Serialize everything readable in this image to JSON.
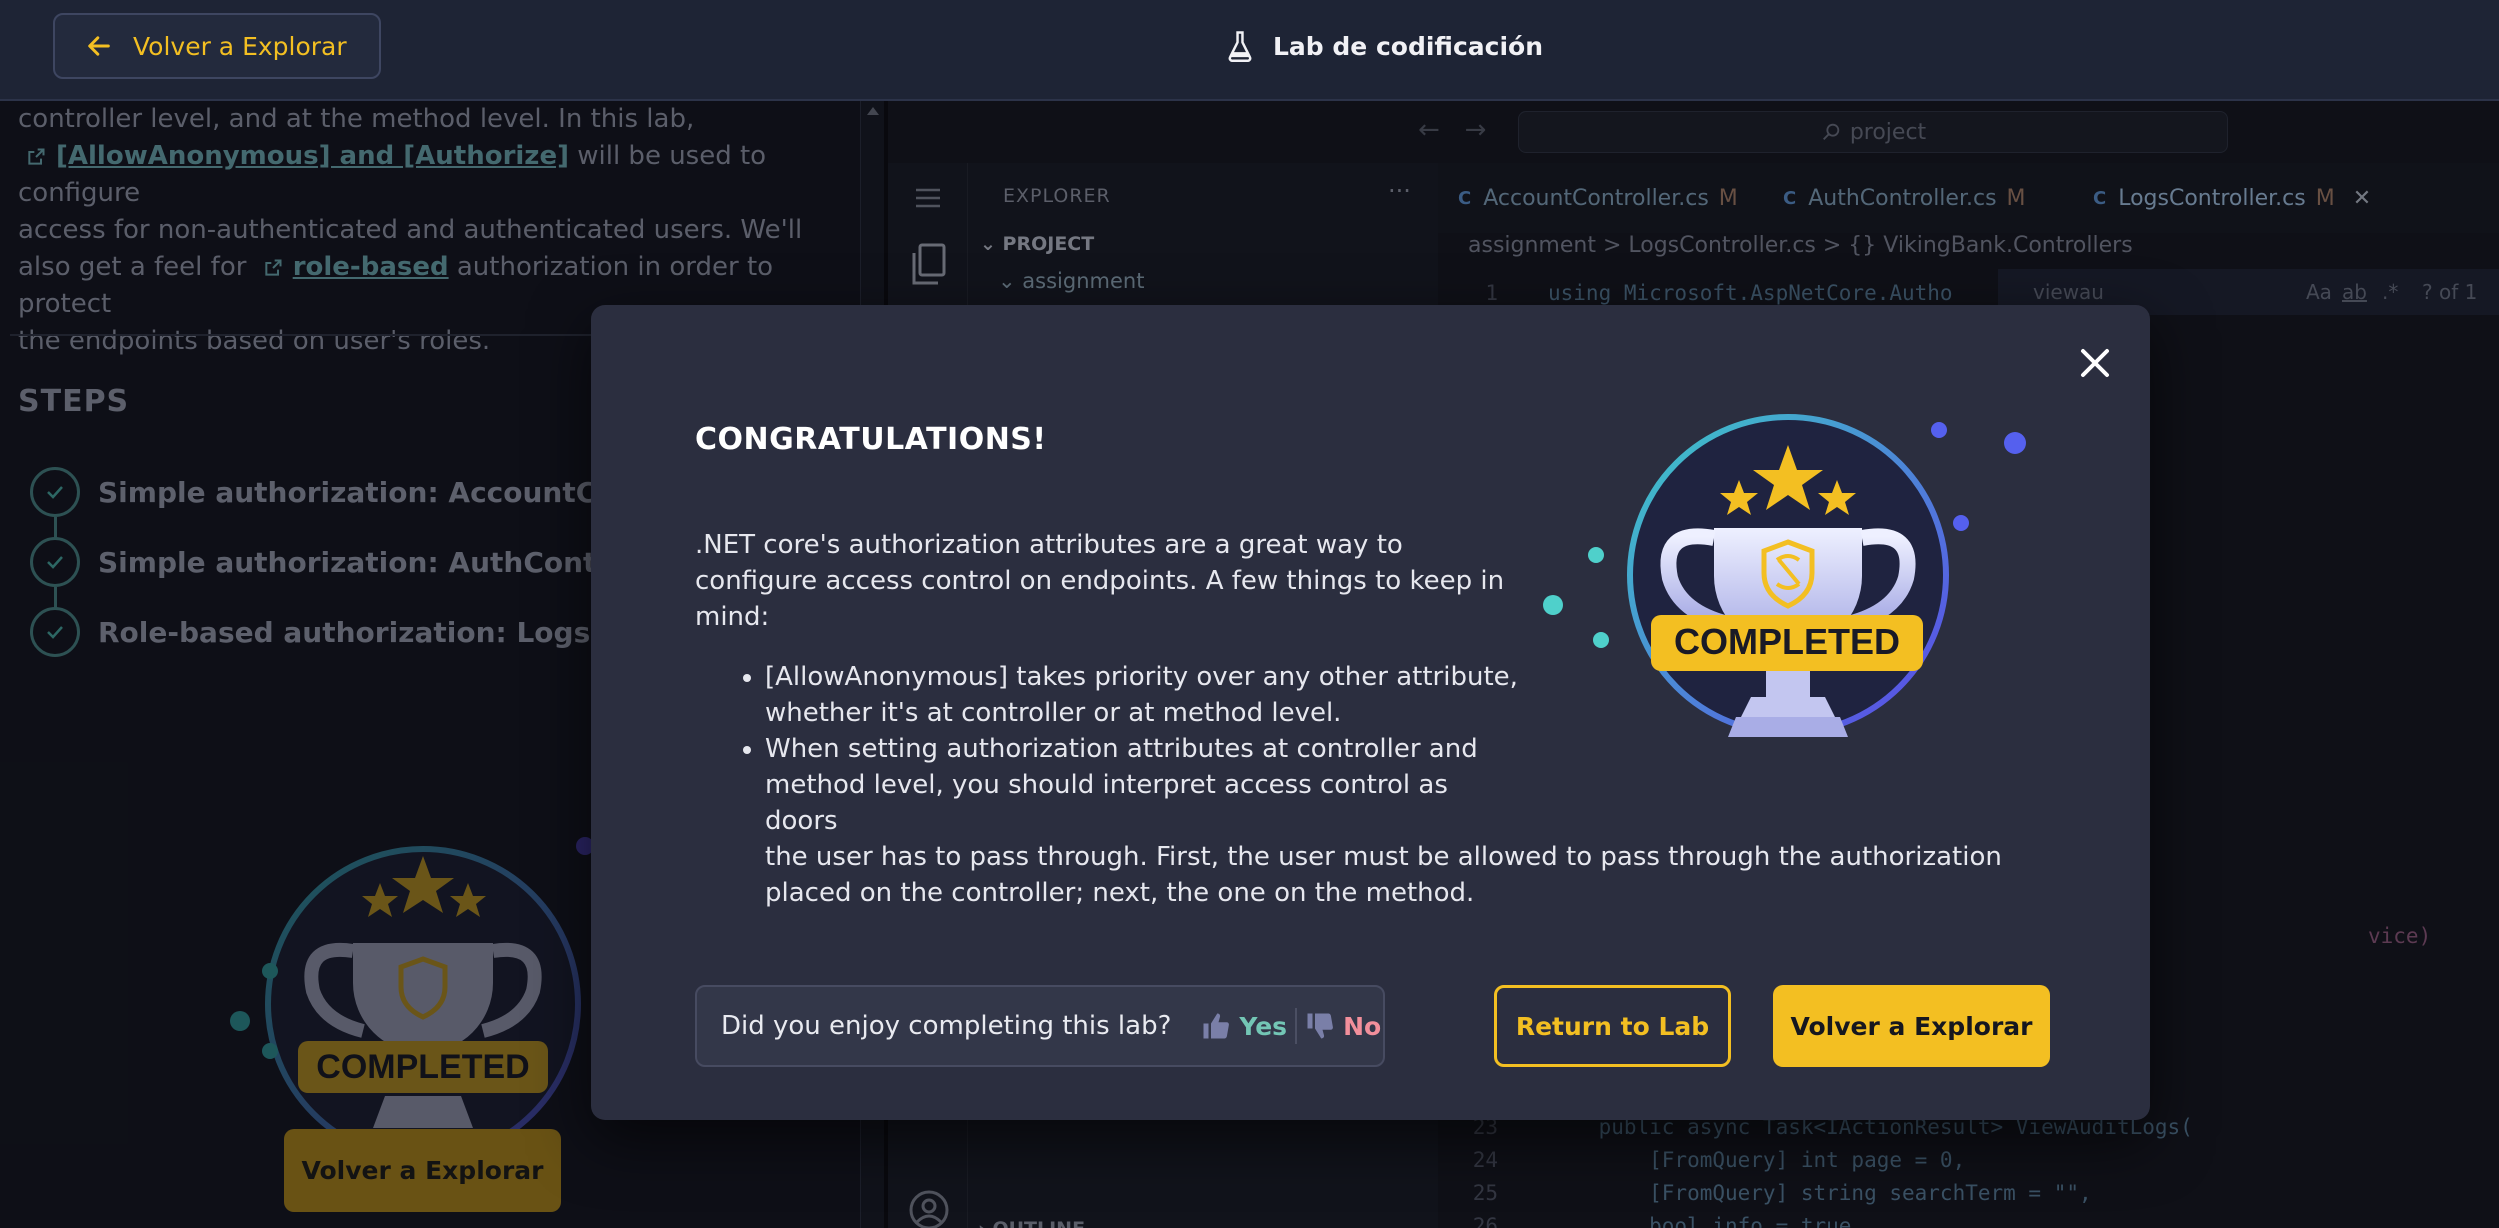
{
  "header": {
    "back_label": "Volver a Explorar",
    "title": "Lab de codificación"
  },
  "left": {
    "intro_line1": "controller level, and at the method level. In this lab,",
    "link1": "[AllowAnonymous] and [Authorize]",
    "intro_line2": " will be used to configure",
    "intro_line3": "access for non-authenticated and authenticated users. We'll",
    "intro_line4a": "also get a feel for ",
    "link2": "role-based",
    "intro_line4b": " authorization in order to protect",
    "intro_line5": "the endpoints based on user's roles.",
    "steps_title": "STEPS",
    "steps": [
      {
        "label": "Simple authorization: AccountContr"
      },
      {
        "label": "Simple authorization: AuthControlle"
      },
      {
        "label": "Role-based authorization: LogsCon"
      }
    ],
    "badge_text": "COMPLETED",
    "explore_label": "Volver a Explorar"
  },
  "ide": {
    "search": "project",
    "explorer_title": "EXPLORER",
    "project": "PROJECT",
    "folder": "assignment",
    "outline": "OUTLINE",
    "tabs": [
      {
        "name": "AccountController.cs",
        "status": "M"
      },
      {
        "name": "AuthController.cs",
        "status": "M"
      },
      {
        "name": "LogsController.cs",
        "status": "M"
      }
    ],
    "breadcrumb": "assignment  >  LogsController.cs  >  {} VikingBank.Controllers",
    "find_value": "viewau",
    "find_count": "? of 1",
    "code": [
      {
        "ln": "1",
        "text": "using Microsoft.AspNetCore.Autho"
      },
      {
        "ln": "23",
        "text": "    public async Task<IActionResult> ViewAuditLogs("
      },
      {
        "ln": "24",
        "text": "        [FromQuery] int page = 0,"
      },
      {
        "ln": "25",
        "text": "        [FromQuery] string searchTerm = \"\","
      },
      {
        "ln": "26",
        "text": "        bool info = true,"
      }
    ],
    "partial": "vice)"
  },
  "modal": {
    "title": "CONGRATULATIONS!",
    "intro": ".NET core's authorization attributes are a great way to configure access control on endpoints. A few things to keep in mind:",
    "bullet1": "[AllowAnonymous] takes priority over any other attribute, whether it's at controller or at method level.",
    "bullet2a": "When setting authorization attributes at controller and method level, you should interpret access control as doors",
    "bullet2b": "the user has to pass through. First, the user must be allowed to pass through the authorization placed on the controller; next, the one on the method.",
    "badge_text": "COMPLETED",
    "feedback_question": "Did you enjoy completing this lab?",
    "yes": "Yes",
    "no": "No",
    "return_label": "Return to Lab",
    "explore_label": "Volver a Explorar"
  },
  "colors": {
    "accent": "#f3bf22",
    "modal_bg": "#2b2e3f",
    "yes": "#73c6b5",
    "no": "#f28f9b"
  }
}
